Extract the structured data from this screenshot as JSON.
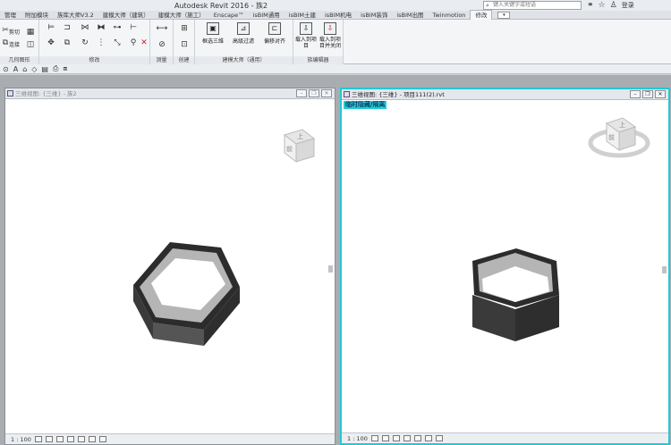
{
  "app": {
    "title": "Autodesk Revit 2016 - 族2",
    "search_placeholder": "键入关键字或短语",
    "login_label": "登录"
  },
  "tabs": [
    "管理",
    "附加模块",
    "族库大师V3.2",
    "建模大师（建筑）",
    "建模大师（施工）",
    "Enscape™",
    "isBIM通用",
    "isBIM土建",
    "isBIM机电",
    "isBIM装饰",
    "isBIM出图",
    "Twinmotion",
    "修改"
  ],
  "active_tab": "修改",
  "ribbon": {
    "clipboard": {
      "cut_label": "剪切",
      "join_label": "连接",
      "group_label": "几何图形"
    },
    "modify": {
      "group_label": "修改"
    },
    "measure": {
      "group_label": "测量"
    },
    "create": {
      "group_label": "创建"
    },
    "jianmo": {
      "select_3d": "框选三维",
      "advanced_filter": "高级过滤",
      "offset_align": "偏移对齐",
      "group_label": "建模大师（通用）"
    },
    "family_editor": {
      "load_project": "载入到项目",
      "load_close": "载入到项目并关闭",
      "group_label": "族编辑器"
    }
  },
  "views": {
    "left": {
      "title": "三维视图: {三维} - 族2",
      "scale": "1 : 100",
      "nav_face_top": "上",
      "nav_face_front": "前"
    },
    "right": {
      "title": "三维视图: {三维} - 项目111(2).rvt",
      "temp_tag": "临时隐藏/隔离",
      "scale": "1 : 100",
      "nav_face_top": "上",
      "nav_face_front": "前"
    }
  },
  "colors": {
    "active_border": "#22c9d6",
    "ribbon_bg": "#f3f5f7",
    "workspace_bg": "#a9adb2"
  }
}
